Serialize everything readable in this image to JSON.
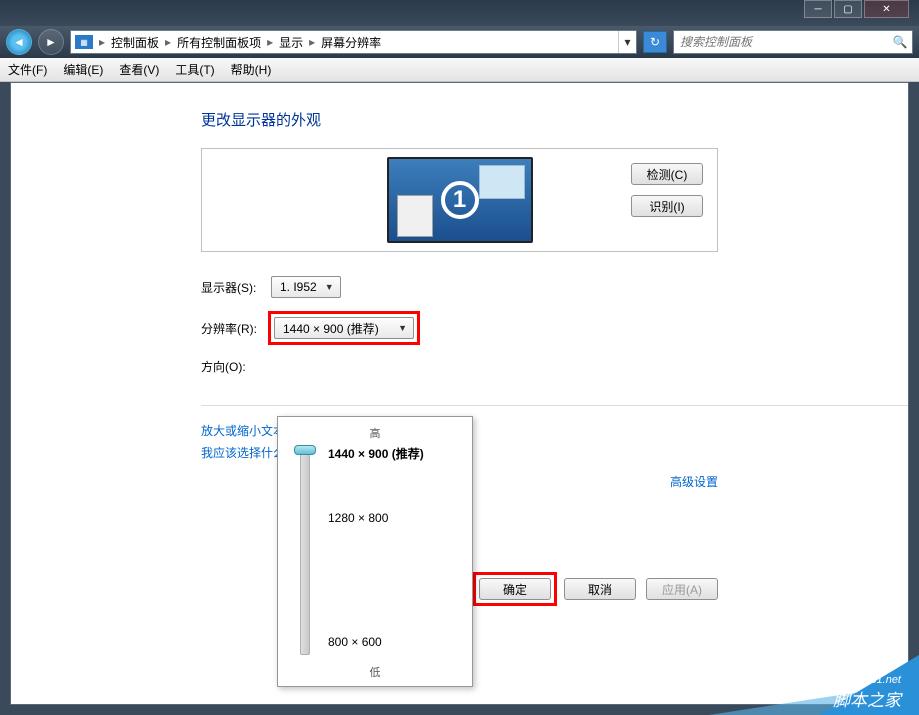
{
  "breadcrumbs": [
    "控制面板",
    "所有控制面板项",
    "显示",
    "屏幕分辨率"
  ],
  "search": {
    "placeholder": "搜索控制面板"
  },
  "menu": {
    "file": "文件(F)",
    "edit": "编辑(E)",
    "view": "查看(V)",
    "tools": "工具(T)",
    "help": "帮助(H)"
  },
  "heading": "更改显示器的外观",
  "monitorNumber": "1",
  "detect": "检测(C)",
  "identify": "识别(I)",
  "labels": {
    "display": "显示器(S):",
    "resolution": "分辨率(R):",
    "orientation": "方向(O):"
  },
  "displayValue": "1. I952",
  "resolutionValue": "1440 × 900 (推荐)",
  "advanced": "高级设置",
  "links": {
    "textsize": "放大或缩小文本和其他项目",
    "which": "我应该选择什么显示器设置?"
  },
  "buttons": {
    "ok": "确定",
    "cancel": "取消",
    "apply": "应用(A)"
  },
  "slider": {
    "high": "高",
    "low": "低"
  },
  "options": {
    "opt1": "1440 × 900 (推荐)",
    "opt2": "1280 × 800",
    "opt3": "800 × 600"
  },
  "watermark": {
    "site": "脚本之家",
    "url": "www.jb51.net"
  }
}
